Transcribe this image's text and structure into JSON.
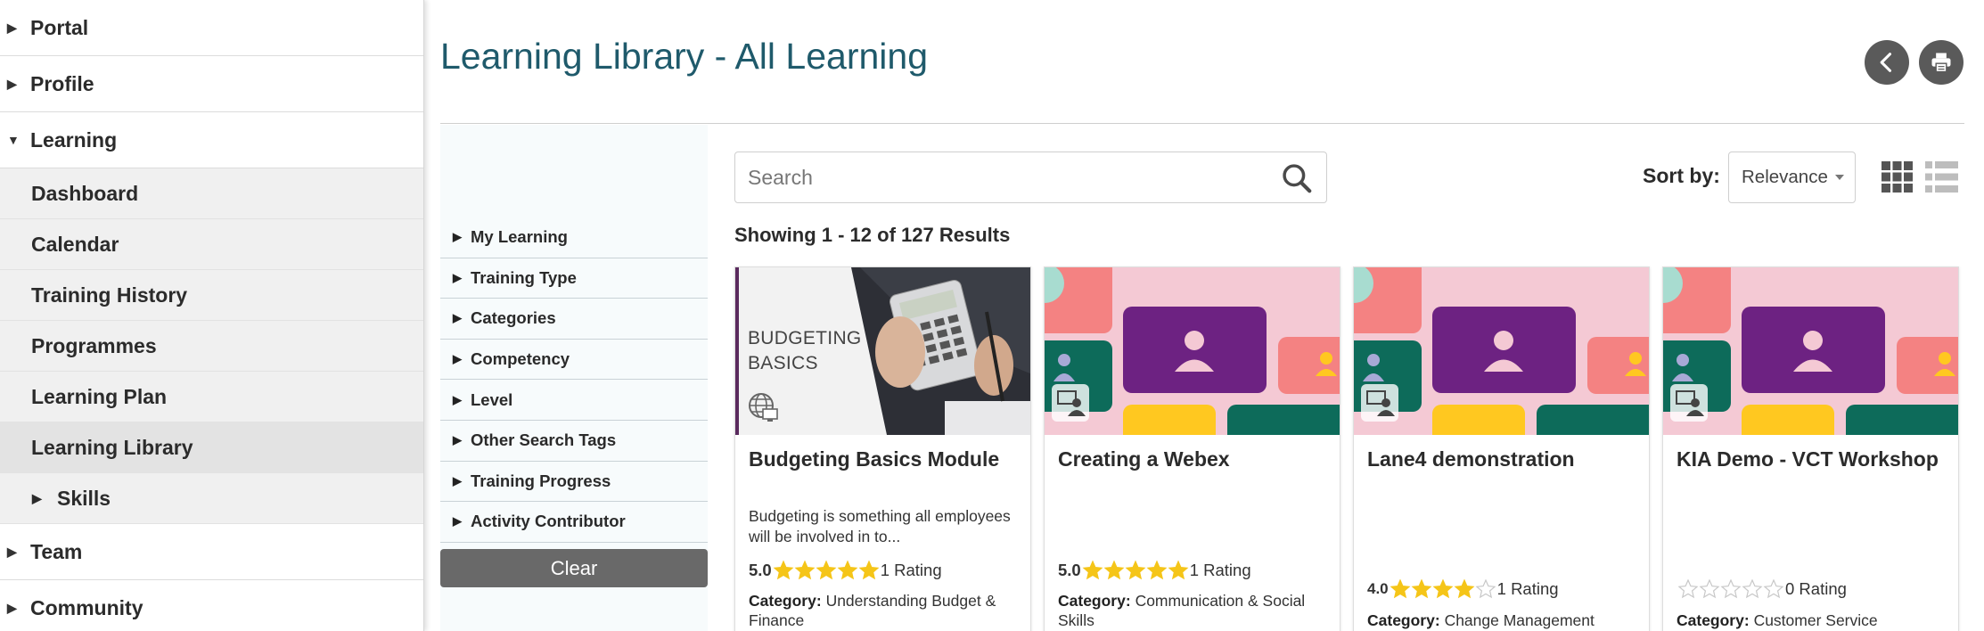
{
  "sidebar": {
    "top_items": [
      {
        "label": "Portal",
        "expanded": false
      },
      {
        "label": "Profile",
        "expanded": false
      },
      {
        "label": "Learning",
        "expanded": true
      }
    ],
    "learning_items": [
      {
        "label": "Dashboard"
      },
      {
        "label": "Calendar"
      },
      {
        "label": "Training History"
      },
      {
        "label": "Programmes"
      },
      {
        "label": "Learning Plan"
      },
      {
        "label": "Learning Library",
        "active": true
      },
      {
        "label": "Skills"
      }
    ],
    "bottom_items": [
      {
        "label": "Team"
      },
      {
        "label": "Community"
      }
    ]
  },
  "header": {
    "title": "Learning Library - All Learning",
    "back_icon": "chevron-left-icon",
    "print_icon": "printer-icon"
  },
  "filters": {
    "items": [
      {
        "label": "My Learning"
      },
      {
        "label": "Training Type"
      },
      {
        "label": "Categories"
      },
      {
        "label": "Competency"
      },
      {
        "label": "Level"
      },
      {
        "label": "Other Search Tags"
      },
      {
        "label": "Training Progress"
      },
      {
        "label": "Activity Contributor"
      }
    ],
    "clear_label": "Clear"
  },
  "search": {
    "placeholder": "Search",
    "value": ""
  },
  "sort": {
    "label": "Sort by:",
    "selected": "Relevance"
  },
  "results_text": "Showing 1 - 12 of 127 Results",
  "colors": {
    "title": "#1f5a6b",
    "star_filled": "#f5c518",
    "button_dark": "#5a5a5a",
    "webex_pink": "#f4c9d4",
    "webex_purple": "#6d2282",
    "webex_green": "#0d6b5a",
    "webex_coral": "#f48282",
    "webex_yellow": "#ffc820"
  },
  "cards": [
    {
      "title": "Budgeting Basics Module",
      "thumb_text_1": "BUDGETING",
      "thumb_text_2": "BASICS",
      "description": "Budgeting is something all employees will be involved in to...",
      "score": "5.0",
      "stars": 5,
      "rating_text": "1 Rating",
      "category_label": "Category:",
      "category": "Understanding Budget & Finance",
      "type_icon": "globe-computer-icon"
    },
    {
      "title": "Creating a Webex",
      "description": "",
      "score": "5.0",
      "stars": 5,
      "rating_text": "1 Rating",
      "category_label": "Category:",
      "category": "Communication & Social Skills",
      "type_icon": "virtual-classroom-icon"
    },
    {
      "title": "Lane4 demonstration",
      "description": "",
      "score": "4.0",
      "stars": 4,
      "rating_text": "1 Rating",
      "category_label": "Category:",
      "category": "Change Management",
      "type_icon": "virtual-classroom-icon"
    },
    {
      "title": "KIA Demo - VCT Workshop",
      "description": "",
      "score": "",
      "stars": 0,
      "rating_text": "0 Rating",
      "category_label": "Category:",
      "category": "Customer Service",
      "type_icon": "virtual-classroom-icon"
    }
  ]
}
